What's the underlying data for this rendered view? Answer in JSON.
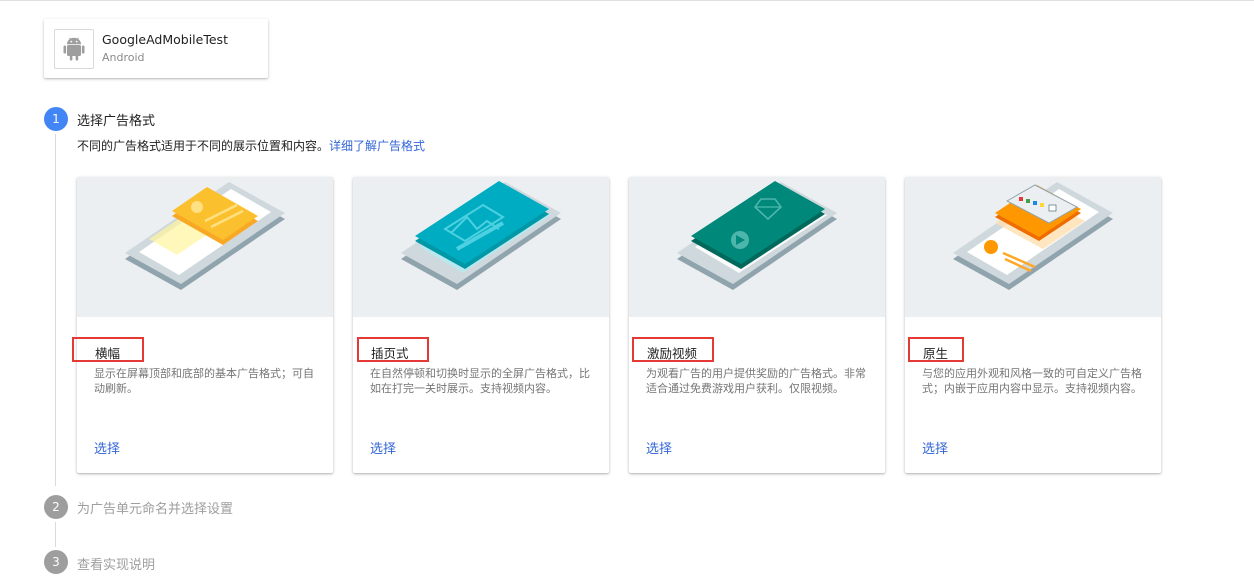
{
  "app": {
    "name": "GoogleAdMobileTest",
    "platform": "Android",
    "icon": "android-icon"
  },
  "steps": [
    {
      "number": "1",
      "title": "选择广告格式",
      "state": "active"
    },
    {
      "number": "2",
      "title": "为广告单元命名并选择设置",
      "state": "inactive"
    },
    {
      "number": "3",
      "title": "查看实现说明",
      "state": "inactive"
    }
  ],
  "step1": {
    "description": "不同的广告格式适用于不同的展示位置和内容。",
    "learn_more": "详细了解广告格式"
  },
  "formats": [
    {
      "title": "横幅",
      "description": "显示在屏幕顶部和底部的基本广告格式；可自动刷新。",
      "action": "选择"
    },
    {
      "title": "插页式",
      "description": "在自然停顿和切换时显示的全屏广告格式，比如在打完一关时展示。支持视频内容。",
      "action": "选择"
    },
    {
      "title": "激励视频",
      "description": "为观看广告的用户提供奖励的广告格式。非常适合通过免费游戏用户获利。仅限视频。",
      "action": "选择"
    },
    {
      "title": "原生",
      "description": "与您的应用外观和风格一致的可自定义广告格式；内嵌于应用内容中显示。支持视频内容。",
      "action": "选择"
    }
  ],
  "colors": {
    "active_step": "#4285f4",
    "inactive_step": "#9e9e9e",
    "link": "#3367d6",
    "highlight_box": "#e53935",
    "banner_ad": "#fbc02d",
    "interstitial_ad": "#00acc1",
    "rewarded_ad": "#00897b",
    "native_ad": "#ff9800"
  }
}
